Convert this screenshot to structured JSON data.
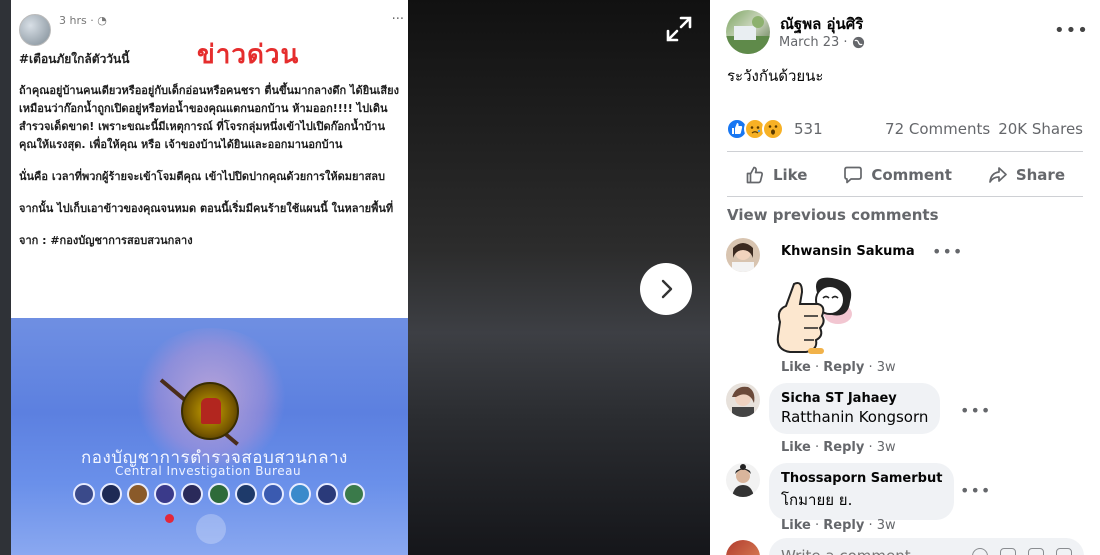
{
  "image": {
    "time": "3 hrs · ◔",
    "menu": "···",
    "hashtag": "#เตือนภัยใกล้ตัววันนี้",
    "headline": "ข่าวด่วน",
    "paragraphs": [
      "ถ้าคุณอยู่บ้านคนเดียวหรืออยู่กับเด็กอ่อนหรือคนชรา ตื่นขึ้นมากลางดึก ได้ยินเสียงเหมือนว่าก๊อกน้ำถูกเปิดอยู่หรือท่อน้ำของคุณแตกนอกบ้าน ห้ามออก!!!! ไปเดินสำรวจเด็ดขาด! เพราะขณะนี้มีเหตุการณ์ ที่โจรกลุ่มหนึ่งเข้าไปเปิดก๊อกน้ำบ้านคุณให้แรงสุด. เพื่อให้คุณ หรือ เจ้าของบ้านได้ยินและออกมานอกบ้าน",
      "นั่นคือ เวลาที่พวกผู้ร้ายจะเข้าโจมตีคุณ เข้าไปปิดปากคุณด้วยการให้ดมยาสลบ",
      "จากนั้น ไปเก็บเอาข้าวของคุณจนหมด ตอนนี้เริ่มมีคนร้ายใช้แผนนี้ ในหลายพื้นที่",
      "จาก : #กองบัญชาการสอบสวนกลาง"
    ],
    "banner_thai": "กองบัญชาการตำรวจสอบสวนกลาง",
    "banner_en": "Central Investigation Bureau",
    "badge_colors": [
      "#3a4a8a",
      "#1e2a55",
      "#8a5a2a",
      "#3a3a8a",
      "#2a2a5a",
      "#2e6b3a",
      "#1e3a6a",
      "#3a5ab0",
      "#3a8acb",
      "#2a3a7a",
      "#3a7a4a"
    ]
  },
  "viewer": {
    "expand_icon": "expand-icon",
    "next_icon": "chevron-right-icon"
  },
  "post": {
    "author": "ณัฐพล อุ่นศิริ",
    "date": "March 23 ·",
    "privacy_icon": "globe-icon",
    "menu": "•••",
    "text": "ระวังกันด้วยนะ",
    "reaction_count": "531",
    "comments_count": "72 Comments",
    "shares_count": "20K Shares",
    "actions": {
      "like": "Like",
      "comment": "Comment",
      "share": "Share"
    },
    "view_previous": "View previous comments"
  },
  "comments": [
    {
      "name": "Khwansin Sakuma",
      "body": "",
      "sticker": true,
      "like": "Like",
      "reply": "Reply",
      "time": "3w"
    },
    {
      "name": "Sicha ST Jahaey",
      "body": "Ratthanin Kongsorn",
      "like": "Like",
      "reply": "Reply",
      "time": "3w"
    },
    {
      "name": "Thossaporn Samerbut",
      "body": "โกมายย ย.",
      "like": "Like",
      "reply": "Reply",
      "time": "3w"
    }
  ],
  "write_comment": {
    "placeholder": "Write a comment..."
  },
  "colors": {
    "accent": "#1877f2",
    "headline_red": "#e52d2d",
    "muted_text": "#65676b"
  }
}
